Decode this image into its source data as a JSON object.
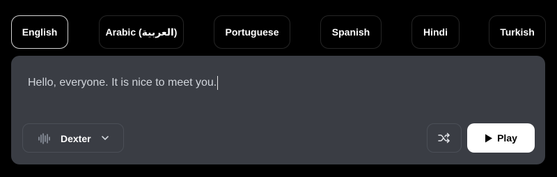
{
  "languages": [
    {
      "label": "English",
      "active": true
    },
    {
      "label": "Arabic (العربية)",
      "active": false
    },
    {
      "label": "Portuguese",
      "active": false
    },
    {
      "label": "Spanish",
      "active": false
    },
    {
      "label": "Hindi",
      "active": false
    },
    {
      "label": "Turkish",
      "active": false
    }
  ],
  "editor": {
    "text": "Hello, everyone. It is nice to meet you."
  },
  "voice": {
    "name": "Dexter",
    "icon": "waveform-icon",
    "dropdown_icon": "chevron-down-icon"
  },
  "controls": {
    "shuffle_icon": "shuffle-icon",
    "play_label": "Play",
    "play_icon": "play-icon"
  },
  "colors": {
    "background": "#000000",
    "panel": "#3a3d44",
    "active_border": "#d4d4d4",
    "play_bg": "#ffffff"
  }
}
